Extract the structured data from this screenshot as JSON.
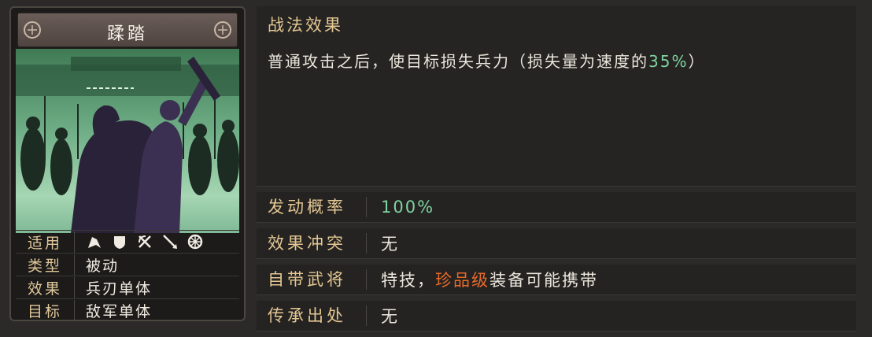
{
  "card": {
    "name": "蹂踏",
    "rows": [
      {
        "key": "适用",
        "icons": [
          "cavalry-icon",
          "shield-icon",
          "crossed-bows-icon",
          "spear-icon",
          "chariot-wheel-icon"
        ]
      },
      {
        "key": "类型",
        "value": "被动"
      },
      {
        "key": "效果",
        "value": "兵刃单体"
      },
      {
        "key": "目标",
        "value": "敌军单体"
      }
    ]
  },
  "effect": {
    "title": "战法效果",
    "description_prefix": "普通攻击之后，使目标损失兵力（损失量为速度的",
    "description_pct": "35%",
    "description_suffix": "）"
  },
  "attributes": [
    {
      "key": "发动概率",
      "value": "100%"
    },
    {
      "key": "效果冲突",
      "value": "无"
    },
    {
      "key": "自带武将",
      "value_prefix": "特技，",
      "value_highlight": "珍品级",
      "value_suffix": "装备可能携带"
    },
    {
      "key": "传承出处",
      "value": "无"
    }
  ],
  "colors": {
    "gold_label": "#e4c793",
    "green_value": "#7fd3a0",
    "orange_highlight": "#e86a2a"
  }
}
